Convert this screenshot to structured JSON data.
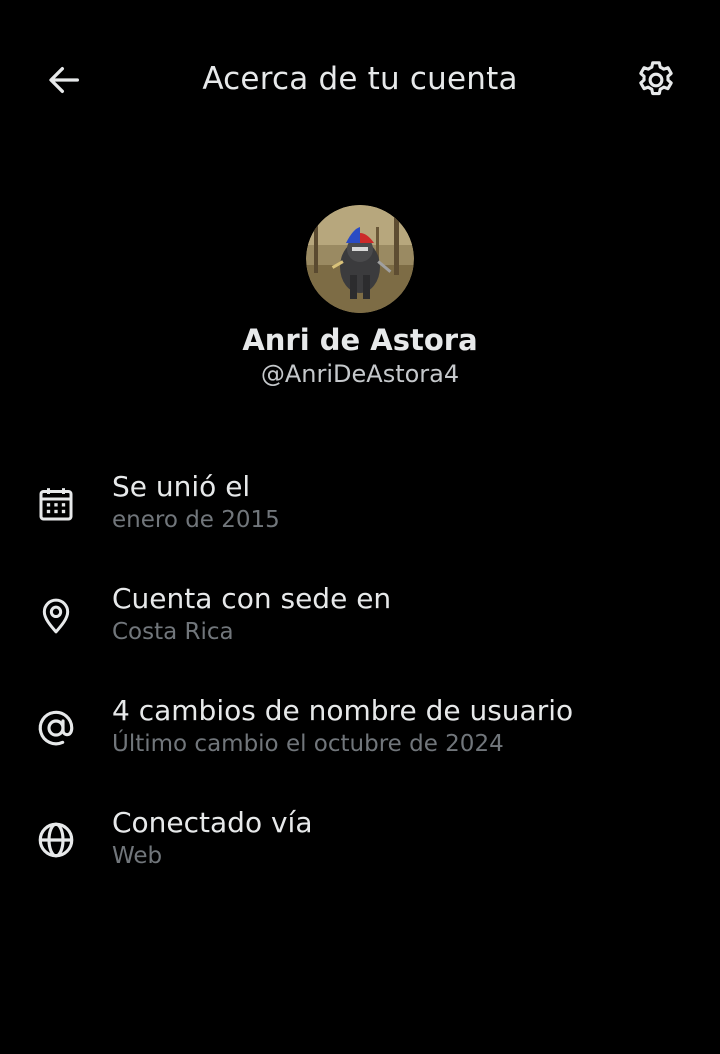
{
  "header": {
    "title": "Acerca de tu cuenta",
    "back_icon": "arrow-left-icon",
    "settings_icon": "gear-icon"
  },
  "profile": {
    "display_name": "Anri de Astora",
    "handle": "@AnriDeAstora4"
  },
  "info": [
    {
      "icon": "calendar-icon",
      "title": "Se unió el",
      "subtitle": "enero de 2015"
    },
    {
      "icon": "location-pin-icon",
      "title": "Cuenta con sede en",
      "subtitle": "Costa Rica"
    },
    {
      "icon": "at-sign-icon",
      "title": "4 cambios de nombre de usuario",
      "subtitle": "Último cambio el octubre de 2024"
    },
    {
      "icon": "globe-icon",
      "title": "Conectado vía",
      "subtitle": "Web"
    }
  ],
  "colors": {
    "background": "#000000",
    "primary_text": "#e7e9ea",
    "secondary_text": "#71767b"
  }
}
